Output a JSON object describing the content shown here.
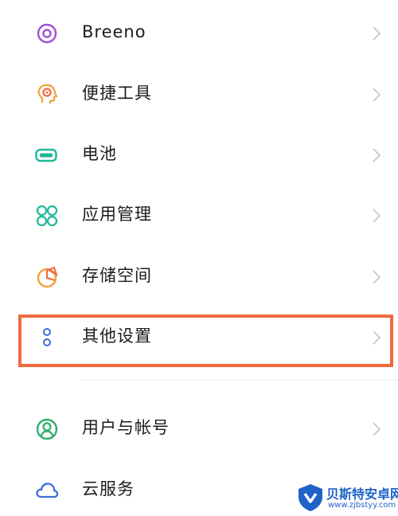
{
  "settings_items": [
    {
      "label": "Breeno",
      "icon": "breeno-icon",
      "color": "#a24fd6"
    },
    {
      "label": "便捷工具",
      "icon": "quick-tools-icon",
      "color": "#f2a23a"
    },
    {
      "label": "电池",
      "icon": "battery-icon",
      "color": "#1fb89a"
    },
    {
      "label": "应用管理",
      "icon": "app-management-icon",
      "color": "#1fb89a"
    },
    {
      "label": "存储空间",
      "icon": "storage-icon",
      "color": "#f2a23a"
    },
    {
      "label": "其他设置",
      "icon": "more-settings-icon",
      "color": "#3a6fd8"
    },
    {
      "label": "用户与帐号",
      "icon": "user-account-icon",
      "color": "#2fae6c"
    },
    {
      "label": "云服务",
      "icon": "cloud-service-icon",
      "color": "#3a6fd8"
    }
  ],
  "highlight_color": "#ef6a3f",
  "watermark": {
    "title": "贝斯特安卓网",
    "url": "www.zjbstyy.com"
  }
}
